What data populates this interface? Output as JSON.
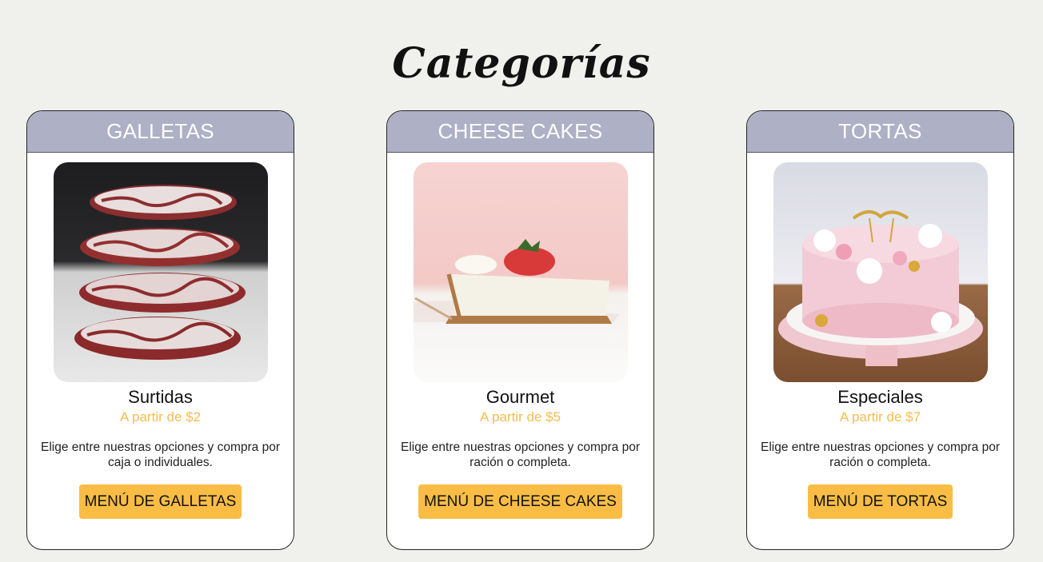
{
  "page": {
    "title": "Categorías"
  },
  "cards": [
    {
      "header": "GALLETAS",
      "image": "red-velvet-cookies-image",
      "name": "Surtidas",
      "price": "A partir de $2",
      "description": "Elige entre nuestras opciones y compra por caja o individuales.",
      "button": "MENÚ DE GALLETAS"
    },
    {
      "header": "CHEESE CAKES",
      "image": "cheesecake-slice-image",
      "name": "Gourmet",
      "price": "A partir de $5",
      "description": "Elige entre nuestras opciones y compra por ración o completa.",
      "button": "MENÚ DE CHEESE CAKES"
    },
    {
      "header": "TORTAS",
      "image": "pink-cake-image",
      "name": "Especiales",
      "price": "A partir de $7",
      "description": "Elige entre nuestras opciones y compra por ración o completa.",
      "button": "MENÚ DE TORTAS"
    }
  ],
  "colors": {
    "background": "#f0f0ec",
    "header": "#aeb0c6",
    "price": "#f6bd4e",
    "button": "#f9bd45"
  }
}
